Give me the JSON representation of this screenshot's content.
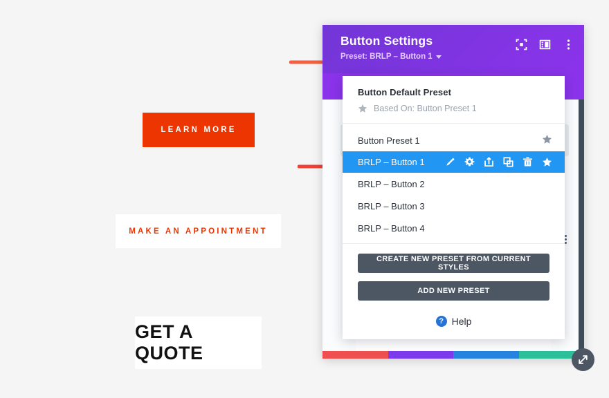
{
  "page": {
    "background_color": "#f5f5f5"
  },
  "preview": {
    "buttons": [
      {
        "label": "Learn More",
        "style": "solid-orange",
        "bg": "#ec3500",
        "fg": "#ffffff"
      },
      {
        "label": "Make an Appointment",
        "style": "white-orange-text",
        "bg": "#ffffff",
        "fg": "#ec3500"
      },
      {
        "label": "Get a Quote",
        "style": "white-black-text",
        "bg": "#ffffff",
        "fg": "#111111"
      }
    ]
  },
  "annotations": {
    "arrows": [
      {
        "name": "arrow-to-preset-line",
        "color": "#f4603f"
      },
      {
        "name": "arrow-to-selected-preset",
        "color": "#ef4136"
      }
    ]
  },
  "modal": {
    "title": "Button Settings",
    "preset_line": "Preset: BRLP – Button 1",
    "accent_color": "#8B33EB",
    "header_icons": [
      {
        "name": "focus-view-icon",
        "label": "Focus View"
      },
      {
        "name": "layout-columns-icon",
        "label": "Layout"
      },
      {
        "name": "kebab-menu-icon",
        "label": "More Options"
      }
    ],
    "scrollbar_color": "#3f4a58",
    "color_strip": [
      "#ef4f4f",
      "#7c3aed",
      "#2684e0",
      "#2bbf9a"
    ]
  },
  "preset_panel": {
    "default_section": {
      "title": "Button Default Preset",
      "based_on": "Based On: Button Preset 1",
      "star_icon": "star-icon"
    },
    "presets": [
      {
        "label": "Button Preset 1",
        "selected": false,
        "has_star": true
      },
      {
        "label": "BRLP – Button 1",
        "selected": true,
        "has_star": false
      },
      {
        "label": "BRLP – Button 2",
        "selected": false,
        "has_star": false
      },
      {
        "label": "BRLP – Button 3",
        "selected": false,
        "has_star": false
      },
      {
        "label": "BRLP – Button 4",
        "selected": false,
        "has_star": false
      }
    ],
    "selected_row_actions": [
      {
        "name": "rename-pencil-icon",
        "label": "Rename"
      },
      {
        "name": "settings-gear-icon",
        "label": "Settings"
      },
      {
        "name": "export-icon",
        "label": "Export"
      },
      {
        "name": "duplicate-icon",
        "label": "Duplicate"
      },
      {
        "name": "delete-trash-icon",
        "label": "Delete"
      },
      {
        "name": "set-default-star-icon",
        "label": "Set As Default"
      }
    ],
    "actions": {
      "create_from_current": "Create New Preset From Current Styles",
      "add_new": "Add New Preset"
    },
    "help": {
      "label": "Help",
      "icon": "question-mark-icon",
      "icon_glyph": "?"
    },
    "selected_color": "#2196f3"
  },
  "resize_handle": {
    "name": "resize-handle",
    "icon": "diagonal-resize-arrow-icon"
  }
}
